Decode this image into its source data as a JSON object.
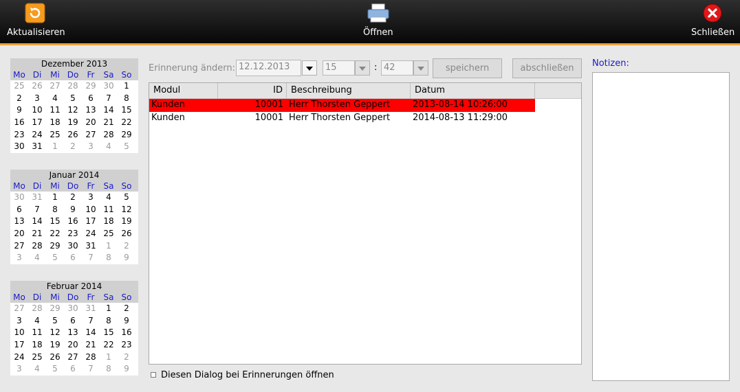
{
  "toolbar": {
    "refresh_label": "Aktualisieren",
    "open_label": "Öffnen",
    "close_label": "Schließen"
  },
  "calendar": {
    "weekdays": [
      "Mo",
      "Di",
      "Mi",
      "Do",
      "Fr",
      "Sa",
      "So"
    ],
    "months": [
      {
        "title": "Dezember 2013",
        "weeks": [
          [
            [
              "25",
              1
            ],
            [
              "26",
              1
            ],
            [
              "27",
              1
            ],
            [
              "28",
              1
            ],
            [
              "29",
              1
            ],
            [
              "30",
              1
            ],
            [
              "1",
              0
            ]
          ],
          [
            [
              "2",
              0
            ],
            [
              "3",
              0
            ],
            [
              "4",
              0
            ],
            [
              "5",
              0
            ],
            [
              "6",
              0
            ],
            [
              "7",
              0
            ],
            [
              "8",
              0
            ]
          ],
          [
            [
              "9",
              0
            ],
            [
              "10",
              0
            ],
            [
              "11",
              0
            ],
            [
              "12",
              0
            ],
            [
              "13",
              0
            ],
            [
              "14",
              0
            ],
            [
              "15",
              0
            ]
          ],
          [
            [
              "16",
              0
            ],
            [
              "17",
              0
            ],
            [
              "18",
              0
            ],
            [
              "19",
              0
            ],
            [
              "20",
              0
            ],
            [
              "21",
              0
            ],
            [
              "22",
              0
            ]
          ],
          [
            [
              "23",
              0
            ],
            [
              "24",
              0
            ],
            [
              "25",
              0
            ],
            [
              "26",
              0
            ],
            [
              "27",
              0
            ],
            [
              "28",
              0
            ],
            [
              "29",
              0
            ]
          ],
          [
            [
              "30",
              0
            ],
            [
              "31",
              0
            ],
            [
              "1",
              1
            ],
            [
              "2",
              1
            ],
            [
              "3",
              1
            ],
            [
              "4",
              1
            ],
            [
              "5",
              1
            ]
          ]
        ]
      },
      {
        "title": "Januar 2014",
        "weeks": [
          [
            [
              "30",
              1
            ],
            [
              "31",
              1
            ],
            [
              "1",
              0
            ],
            [
              "2",
              0
            ],
            [
              "3",
              0
            ],
            [
              "4",
              0
            ],
            [
              "5",
              0
            ]
          ],
          [
            [
              "6",
              0
            ],
            [
              "7",
              0
            ],
            [
              "8",
              0
            ],
            [
              "9",
              0
            ],
            [
              "10",
              0
            ],
            [
              "11",
              0
            ],
            [
              "12",
              0
            ]
          ],
          [
            [
              "13",
              0
            ],
            [
              "14",
              0
            ],
            [
              "15",
              0
            ],
            [
              "16",
              0
            ],
            [
              "17",
              0
            ],
            [
              "18",
              0
            ],
            [
              "19",
              0
            ]
          ],
          [
            [
              "20",
              0
            ],
            [
              "21",
              0
            ],
            [
              "22",
              0
            ],
            [
              "23",
              0
            ],
            [
              "24",
              0
            ],
            [
              "25",
              0
            ],
            [
              "26",
              0
            ]
          ],
          [
            [
              "27",
              0
            ],
            [
              "28",
              0
            ],
            [
              "29",
              0
            ],
            [
              "30",
              0
            ],
            [
              "31",
              0
            ],
            [
              "1",
              1
            ],
            [
              "2",
              1
            ]
          ],
          [
            [
              "3",
              1
            ],
            [
              "4",
              1
            ],
            [
              "5",
              1
            ],
            [
              "6",
              1
            ],
            [
              "7",
              1
            ],
            [
              "8",
              1
            ],
            [
              "9",
              1
            ]
          ]
        ]
      },
      {
        "title": "Februar 2014",
        "weeks": [
          [
            [
              "27",
              1
            ],
            [
              "28",
              1
            ],
            [
              "29",
              1
            ],
            [
              "30",
              1
            ],
            [
              "31",
              1
            ],
            [
              "1",
              0
            ],
            [
              "2",
              0
            ]
          ],
          [
            [
              "3",
              0
            ],
            [
              "4",
              0
            ],
            [
              "5",
              0
            ],
            [
              "6",
              0
            ],
            [
              "7",
              0
            ],
            [
              "8",
              0
            ],
            [
              "9",
              0
            ]
          ],
          [
            [
              "10",
              0
            ],
            [
              "11",
              0
            ],
            [
              "12",
              0
            ],
            [
              "13",
              0
            ],
            [
              "14",
              0
            ],
            [
              "15",
              0
            ],
            [
              "16",
              0
            ]
          ],
          [
            [
              "17",
              0
            ],
            [
              "18",
              0
            ],
            [
              "19",
              0
            ],
            [
              "20",
              0
            ],
            [
              "21",
              0
            ],
            [
              "22",
              0
            ],
            [
              "23",
              0
            ]
          ],
          [
            [
              "24",
              0
            ],
            [
              "25",
              0
            ],
            [
              "26",
              0
            ],
            [
              "27",
              0
            ],
            [
              "28",
              0
            ],
            [
              "1",
              1
            ],
            [
              "2",
              1
            ]
          ],
          [
            [
              "3",
              1
            ],
            [
              "4",
              1
            ],
            [
              "5",
              1
            ],
            [
              "6",
              1
            ],
            [
              "7",
              1
            ],
            [
              "8",
              1
            ],
            [
              "9",
              1
            ]
          ]
        ]
      }
    ]
  },
  "reminder": {
    "label": "Erinnerung ändern:",
    "date": "12.12.2013",
    "hour": "15",
    "separator": ":",
    "minute": "42",
    "save_label": "speichern",
    "finish_label": "abschließen"
  },
  "table": {
    "headers": [
      "Modul",
      "ID",
      "Beschreibung",
      "Datum",
      ""
    ],
    "rows": [
      [
        "Kunden",
        "10001",
        "Herr Thorsten Geppert",
        "2013-08-14 10:26:00"
      ],
      [
        "Kunden",
        "10001",
        "Herr Thorsten Geppert",
        "2014-08-13 11:29:00"
      ]
    ]
  },
  "dialog_checkbox_label": "Diesen Dialog bei Erinnerungen öffnen",
  "notes": {
    "label": "Notizen:",
    "content": ""
  }
}
